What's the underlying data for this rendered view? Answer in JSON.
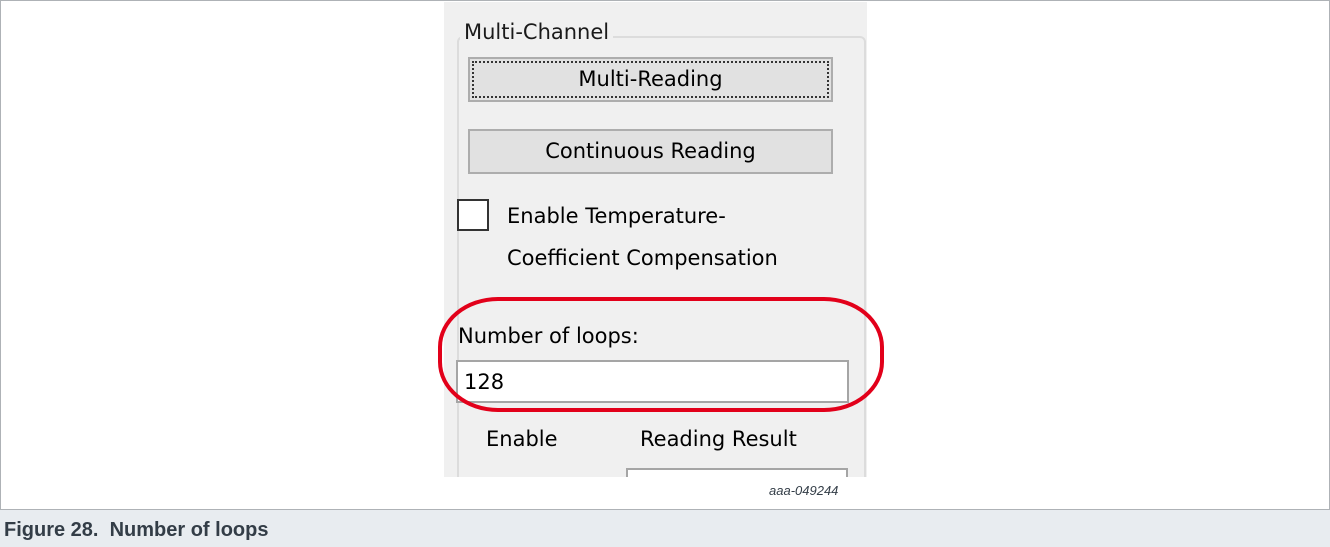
{
  "groupbox": {
    "title": "Multi-Channel"
  },
  "buttons": {
    "multi_reading": "Multi-Reading",
    "continuous_reading": "Continuous Reading"
  },
  "checkbox": {
    "checked": false,
    "label": "Enable Temperature-\nCoefficient Compensation"
  },
  "loops": {
    "label": "Number of loops:",
    "value": "128"
  },
  "columns": {
    "enable": "Enable",
    "reading_result": "Reading Result"
  },
  "figure": {
    "id": "aaa-049244",
    "caption": "Figure 28.  Number of loops"
  },
  "colors": {
    "highlight": "#e2001a",
    "caption_bar": "#e8ecf0",
    "window_bg": "#f0f0f0"
  }
}
